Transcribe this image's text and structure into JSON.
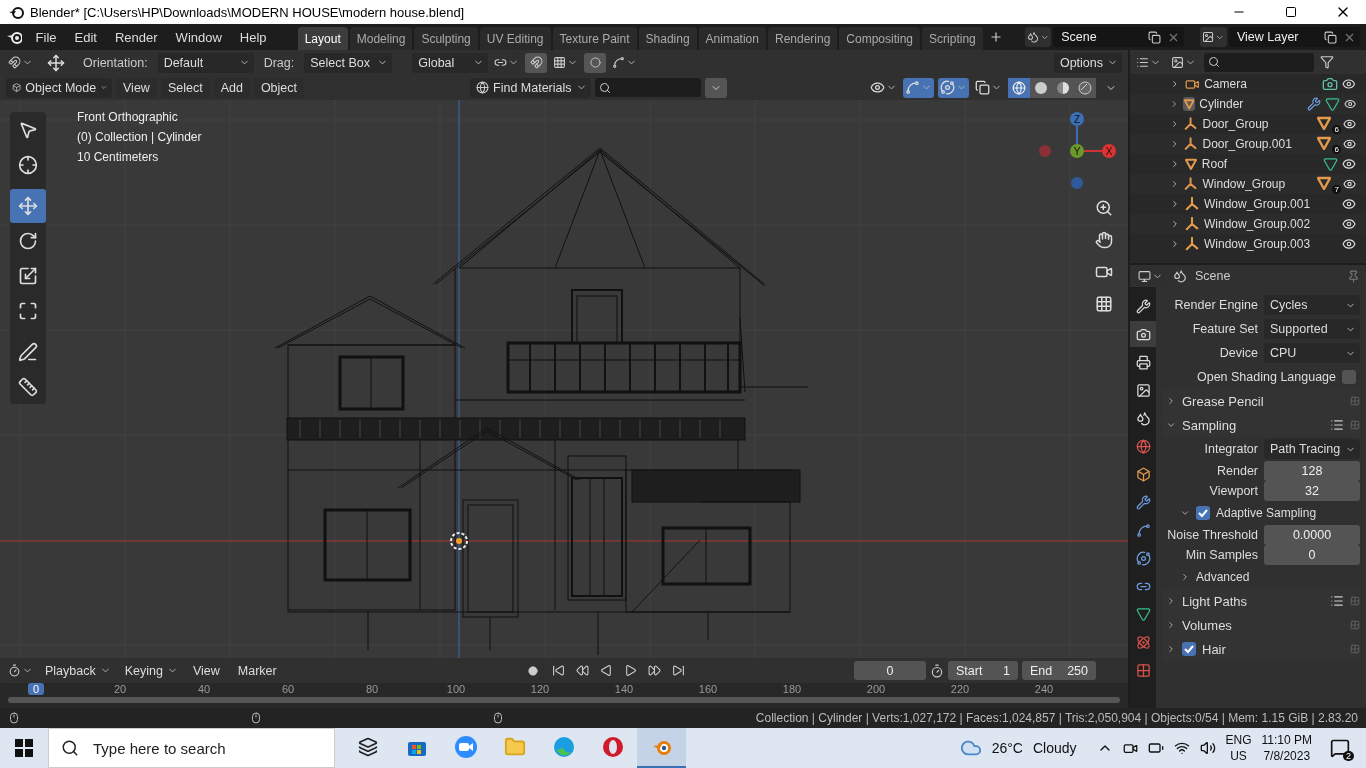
{
  "window": {
    "title": "Blender* [C:\\Users\\HP\\Downloads\\MODERN HOUSE\\modern house.blend]"
  },
  "menu": [
    "File",
    "Edit",
    "Render",
    "Window",
    "Help"
  ],
  "workspaces": [
    {
      "label": "Layout",
      "selected": true
    },
    {
      "label": "Modeling",
      "selected": false
    },
    {
      "label": "Sculpting",
      "selected": false
    },
    {
      "label": "UV Editing",
      "selected": false
    },
    {
      "label": "Texture Paint",
      "selected": false
    },
    {
      "label": "Shading",
      "selected": false
    },
    {
      "label": "Animation",
      "selected": false
    },
    {
      "label": "Rendering",
      "selected": false
    },
    {
      "label": "Compositing",
      "selected": false
    },
    {
      "label": "Scripting",
      "selected": false
    }
  ],
  "scene": {
    "value": "Scene"
  },
  "view_layer": {
    "value": "View Layer"
  },
  "tool_header": {
    "orientation_label": "Orientation:",
    "orientation": "Default",
    "drag_label": "Drag:",
    "drag": "Select Box",
    "transform": "Global",
    "options": "Options"
  },
  "viewport_header": {
    "mode": "Object Mode",
    "menus": [
      "View",
      "Select",
      "Add",
      "Object"
    ],
    "find": "Find Materials",
    "toggles": [
      {
        "kind": "visibility",
        "selected": false
      },
      {
        "kind": "gizmo",
        "selected": true
      },
      {
        "kind": "overlay",
        "selected": true
      },
      {
        "kind": "xray",
        "selected": false
      }
    ],
    "shading": [
      {
        "kind": "wireframe",
        "selected": true
      },
      {
        "kind": "solid",
        "selected": false
      },
      {
        "kind": "material",
        "selected": false
      },
      {
        "kind": "rendered",
        "selected": false
      }
    ]
  },
  "viewport": {
    "info": [
      "Front Orthographic",
      "(0) Collection | Cylinder",
      "10 Centimeters"
    ],
    "gizmo": {
      "z": "Z",
      "y": "Y",
      "x": "X"
    }
  },
  "tools": [
    {
      "kind": "select-box",
      "selected": false
    },
    {
      "kind": "cursor",
      "selected": false
    },
    {
      "kind": "move",
      "selected": true
    },
    {
      "kind": "rotate",
      "selected": false
    },
    {
      "kind": "scale",
      "selected": false
    },
    {
      "kind": "transform",
      "selected": false
    },
    {
      "kind": "annotate",
      "selected": false
    },
    {
      "kind": "measure",
      "selected": false
    }
  ],
  "outliner": {
    "items": [
      {
        "name": "Camera",
        "kind": "camera",
        "active": false,
        "expanded": false,
        "extras": [
          {
            "kind": "camera-data"
          }
        ]
      },
      {
        "name": "Cylinder",
        "kind": "mesh",
        "active": true,
        "expanded": false,
        "extras": [
          {
            "kind": "modifier"
          },
          {
            "kind": "mesh-data"
          }
        ]
      },
      {
        "name": "Door_Group",
        "kind": "empty",
        "active": false,
        "expanded": false,
        "extras": [
          {
            "kind": "mesh-children",
            "count": "6"
          }
        ]
      },
      {
        "name": "Door_Group.001",
        "kind": "empty",
        "active": false,
        "expanded": false,
        "extras": [
          {
            "kind": "mesh-children",
            "count": "6"
          }
        ]
      },
      {
        "name": "Roof",
        "kind": "mesh",
        "active": false,
        "expanded": false,
        "extras": [
          {
            "kind": "mesh-data"
          }
        ]
      },
      {
        "name": "Window_Group",
        "kind": "empty",
        "active": false,
        "expanded": false,
        "extras": [
          {
            "kind": "mesh-children",
            "count": "7"
          }
        ]
      },
      {
        "name": "Window_Group.001",
        "kind": "empty",
        "active": false,
        "expanded": false
      },
      {
        "name": "Window_Group.002",
        "kind": "empty",
        "active": false,
        "expanded": false
      },
      {
        "name": "Window_Group.003",
        "kind": "empty",
        "active": false,
        "expanded": false
      }
    ]
  },
  "properties": {
    "title": "Scene",
    "tabs": [
      {
        "kind": "tool",
        "selected": false
      },
      {
        "kind": "render",
        "selected": true
      },
      {
        "kind": "output",
        "selected": false
      },
      {
        "kind": "view-layer",
        "selected": false
      },
      {
        "kind": "scene",
        "selected": false
      },
      {
        "kind": "world",
        "selected": false
      },
      {
        "kind": "object",
        "selected": false
      },
      {
        "kind": "modifiers",
        "selected": false
      },
      {
        "kind": "particles",
        "selected": false
      },
      {
        "kind": "physics",
        "selected": false
      },
      {
        "kind": "constraints",
        "selected": false
      },
      {
        "kind": "data",
        "selected": false
      },
      {
        "kind": "material",
        "selected": false
      },
      {
        "kind": "texture",
        "selected": false
      }
    ],
    "rows": [
      {
        "kind": "dropdown",
        "label": "Render Engine",
        "value": "Cycles"
      },
      {
        "kind": "dropdown",
        "label": "Feature Set",
        "value": "Supported"
      },
      {
        "kind": "dropdown",
        "label": "Device",
        "value": "CPU"
      },
      {
        "kind": "checkbox",
        "label": "Open Shading Language",
        "checked": false
      },
      {
        "kind": "panel",
        "label": "Grease Pencil",
        "expanded": false,
        "presets": false
      },
      {
        "kind": "panel",
        "label": "Sampling",
        "expanded": true,
        "presets": true
      },
      {
        "kind": "dropdown",
        "label": "Integrator",
        "value": "Path Tracing"
      },
      {
        "kind": "number",
        "label": "Render",
        "value": "128"
      },
      {
        "kind": "number",
        "label": "Viewport",
        "value": "32"
      },
      {
        "kind": "subpanel",
        "label": "Adaptive Sampling",
        "expanded": true,
        "checked": true
      },
      {
        "kind": "number",
        "label": "Noise Threshold",
        "value": "0.0000"
      },
      {
        "kind": "number",
        "label": "Min Samples",
        "value": "0"
      },
      {
        "kind": "subpanel",
        "label": "Advanced",
        "expanded": false
      },
      {
        "kind": "panel",
        "label": "Light Paths",
        "expanded": false,
        "presets": true
      },
      {
        "kind": "panel",
        "label": "Volumes",
        "expanded": false,
        "presets": false
      },
      {
        "kind": "panel",
        "label": "Hair",
        "expanded": false,
        "presets": false,
        "checked": true
      }
    ]
  },
  "timeline": {
    "menus": [
      {
        "label": "Playback",
        "dropdown": true
      },
      {
        "label": "Keying",
        "dropdown": true
      },
      {
        "label": "View",
        "dropdown": false
      },
      {
        "label": "Marker",
        "dropdown": false
      }
    ],
    "frame": "0",
    "start_label": "Start",
    "start": "1",
    "end_label": "End",
    "end": "250",
    "current_frame": "0",
    "ticks": [
      "20",
      "40",
      "60",
      "80",
      "100",
      "120",
      "140",
      "160",
      "180",
      "200",
      "220",
      "240"
    ]
  },
  "status_bar": "Collection | Cylinder | Verts:1,027,172 | Faces:1,024,857 | Tris:2,050,904 | Objects:0/54 | Mem: 1.15 GiB | 2.83.20",
  "taskbar": {
    "search_placeholder": "Type here to search",
    "apps": [
      {
        "kind": "task-view",
        "active": false
      },
      {
        "kind": "store",
        "active": false
      },
      {
        "kind": "zoom",
        "active": false
      },
      {
        "kind": "explorer",
        "active": false
      },
      {
        "kind": "edge",
        "active": false
      },
      {
        "kind": "opera",
        "active": false
      },
      {
        "kind": "blender",
        "active": true
      }
    ],
    "temperature": "26°C",
    "weather": "Cloudy",
    "language": "ENG",
    "region": "US",
    "time": "11:10 PM",
    "date": "7/8/2023",
    "notifications": "2"
  }
}
